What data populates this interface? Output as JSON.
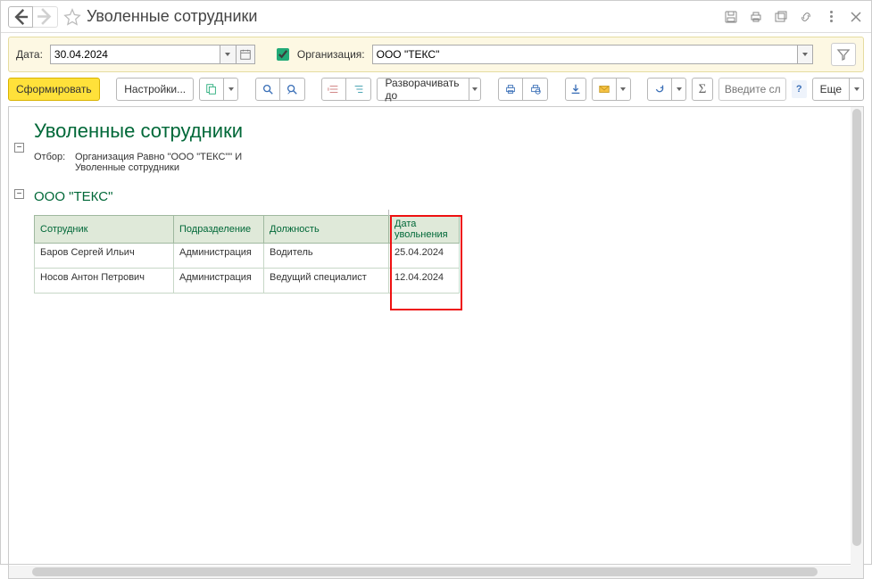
{
  "window": {
    "title": "Уволенные сотрудники"
  },
  "filter": {
    "date_label": "Дата:",
    "date_value": "30.04.2024",
    "org_label": "Организация:",
    "org_value": "ООО \"ТЕКС\""
  },
  "toolbar": {
    "generate": "Сформировать",
    "settings": "Настройки...",
    "expand": "Разворачивать до",
    "more": "Еще",
    "search_placeholder": "Введите сл..."
  },
  "report": {
    "title": "Уволенные сотрудники",
    "filter_label": "Отбор:",
    "filter_text_l1": "Организация Равно \"ООО \"ТЕКС\"\" И",
    "filter_text_l2": "Уволенные сотрудники",
    "org_heading": "ООО \"ТЕКС\"",
    "columns": {
      "employee": "Сотрудник",
      "department": "Подразделение",
      "position": "Должность",
      "dismissal_date": "Дата увольнения"
    },
    "rows": [
      {
        "employee": "Баров Сергей Ильич",
        "department": "Администрация",
        "position": "Водитель",
        "date": "25.04.2024"
      },
      {
        "employee": "Носов Антон Петрович",
        "department": "Администрация",
        "position": "Ведущий специалист",
        "date": "12.04.2024"
      }
    ]
  }
}
